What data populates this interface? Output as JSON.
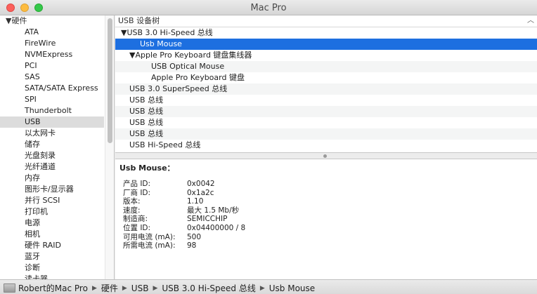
{
  "window": {
    "title": "Mac Pro"
  },
  "sidebar": {
    "header": "▼硬件",
    "items": [
      {
        "label": "ATA"
      },
      {
        "label": "FireWire"
      },
      {
        "label": "NVMExpress"
      },
      {
        "label": "PCI"
      },
      {
        "label": "SAS"
      },
      {
        "label": "SATA/SATA Express"
      },
      {
        "label": "SPI"
      },
      {
        "label": "Thunderbolt"
      },
      {
        "label": "USB",
        "selected": true
      },
      {
        "label": "以太网卡"
      },
      {
        "label": "储存"
      },
      {
        "label": "光盘刻录"
      },
      {
        "label": "光纤通道"
      },
      {
        "label": "内存"
      },
      {
        "label": "图形卡/显示器"
      },
      {
        "label": "并行 SCSI"
      },
      {
        "label": "打印机"
      },
      {
        "label": "电源"
      },
      {
        "label": "相机"
      },
      {
        "label": "硬件 RAID"
      },
      {
        "label": "蓝牙"
      },
      {
        "label": "诊断"
      },
      {
        "label": "读卡器"
      }
    ]
  },
  "tree": {
    "header": "USB 设备树",
    "rows": [
      {
        "label": "▼USB 3.0 Hi-Speed 总线",
        "level": 0
      },
      {
        "label": "Usb Mouse",
        "level": 2,
        "selected": true
      },
      {
        "label": "▼Apple Pro Keyboard 键盘集线器",
        "level": 1
      },
      {
        "label": "USB Optical Mouse",
        "level": 3
      },
      {
        "label": "Apple Pro Keyboard 键盘",
        "level": 3
      },
      {
        "label": "USB 3.0 SuperSpeed 总线",
        "level": 1
      },
      {
        "label": "USB 总线",
        "level": 1
      },
      {
        "label": "USB 总线",
        "level": 1
      },
      {
        "label": "USB 总线",
        "level": 1
      },
      {
        "label": "USB 总线",
        "level": 1
      },
      {
        "label": "USB Hi-Speed 总线",
        "level": 1
      }
    ]
  },
  "detail": {
    "title": "Usb Mouse：",
    "properties": [
      {
        "label": "产品 ID:",
        "value": "0x0042"
      },
      {
        "label": "厂商 ID:",
        "value": "0x1a2c"
      },
      {
        "label": "版本:",
        "value": "1.10"
      },
      {
        "label": "速度:",
        "value": "最大 1.5 Mb/秒"
      },
      {
        "label": "制造商:",
        "value": "SEMICCHIP"
      },
      {
        "label": "位置 ID:",
        "value": "0x04400000 / 8"
      },
      {
        "label": "可用电流 (mA):",
        "value": "500"
      },
      {
        "label": "所需电流 (mA):",
        "value": "98"
      }
    ]
  },
  "breadcrumb": {
    "items": [
      "Robert的Mac Pro",
      "硬件",
      "USB",
      "USB 3.0 Hi-Speed 总线",
      "Usb Mouse"
    ],
    "separator": "▶"
  }
}
